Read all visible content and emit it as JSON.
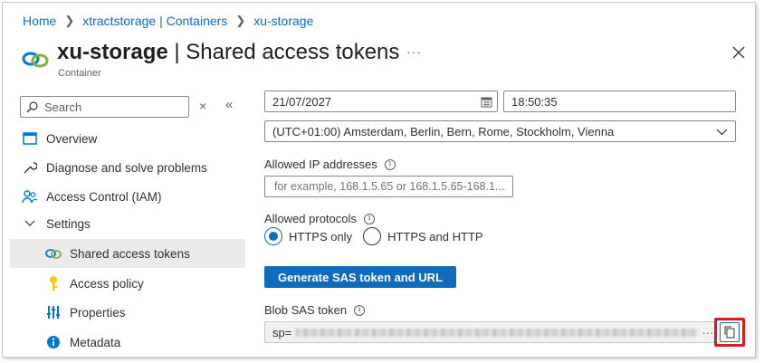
{
  "breadcrumb": [
    "Home",
    "xtractstorage | Containers",
    "xu-storage"
  ],
  "header": {
    "title_bold": "xu-storage",
    "title_rest": " | Shared access tokens",
    "subtitle": "Container",
    "more": "···"
  },
  "sidebar": {
    "search_placeholder": "Search",
    "collapse_icon": "×",
    "chevron_icon": "«",
    "items": [
      {
        "label": "Overview",
        "icon": "overview-icon"
      },
      {
        "label": "Diagnose and solve problems",
        "icon": "wrench-icon"
      },
      {
        "label": "Access Control (IAM)",
        "icon": "people-icon"
      },
      {
        "label": "Settings",
        "icon": "chevron-down-icon"
      },
      {
        "label": "Shared access tokens",
        "icon": "link-icon",
        "active": true
      },
      {
        "label": "Access policy",
        "icon": "key-icon"
      },
      {
        "label": "Properties",
        "icon": "properties-icon"
      },
      {
        "label": "Metadata",
        "icon": "info-icon"
      }
    ]
  },
  "main": {
    "expiry_date": "21/07/2027",
    "expiry_time": "18:50:35",
    "timezone": "(UTC+01:00) Amsterdam, Berlin, Bern, Rome, Stockholm, Vienna",
    "allowed_ip_label": "Allowed IP addresses",
    "allowed_ip_placeholder": "for example, 168.1.5.65 or 168.1.5.65-168.1....",
    "protocols_label": "Allowed protocols",
    "protocol_https": "HTTPS only",
    "protocol_both": "HTTPS and HTTP",
    "generate_button": "Generate SAS token and URL",
    "blob_sas_label": "Blob SAS token",
    "blob_sas_prefix": "sp=",
    "blob_sas_suffix": "···"
  },
  "colors": {
    "accent": "#0f6cbd",
    "highlight": "#d61d1d"
  }
}
